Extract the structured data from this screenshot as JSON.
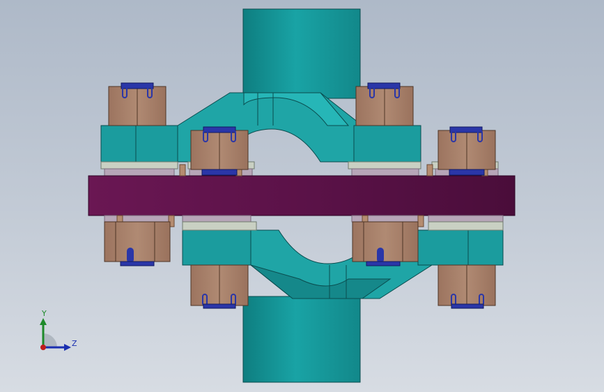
{
  "viewport": {
    "background_top": "#aeb9c8",
    "background_bottom": "#d7dce3"
  },
  "model": {
    "colors": {
      "shaft": "#16999b",
      "clamp_body": "#1fa5a6",
      "flange_plate": "#5c1448",
      "bolt_block": "#a8806a",
      "nut_insert": "#2a36a8",
      "washer": "#c9d0c3"
    }
  },
  "triad": {
    "y_label": "Y",
    "z_label": "Z",
    "y_color": "#1e8a2a",
    "z_color": "#1a2fb0",
    "x_color": "#c01c1c",
    "icon": "coordinate-triad-icon"
  }
}
